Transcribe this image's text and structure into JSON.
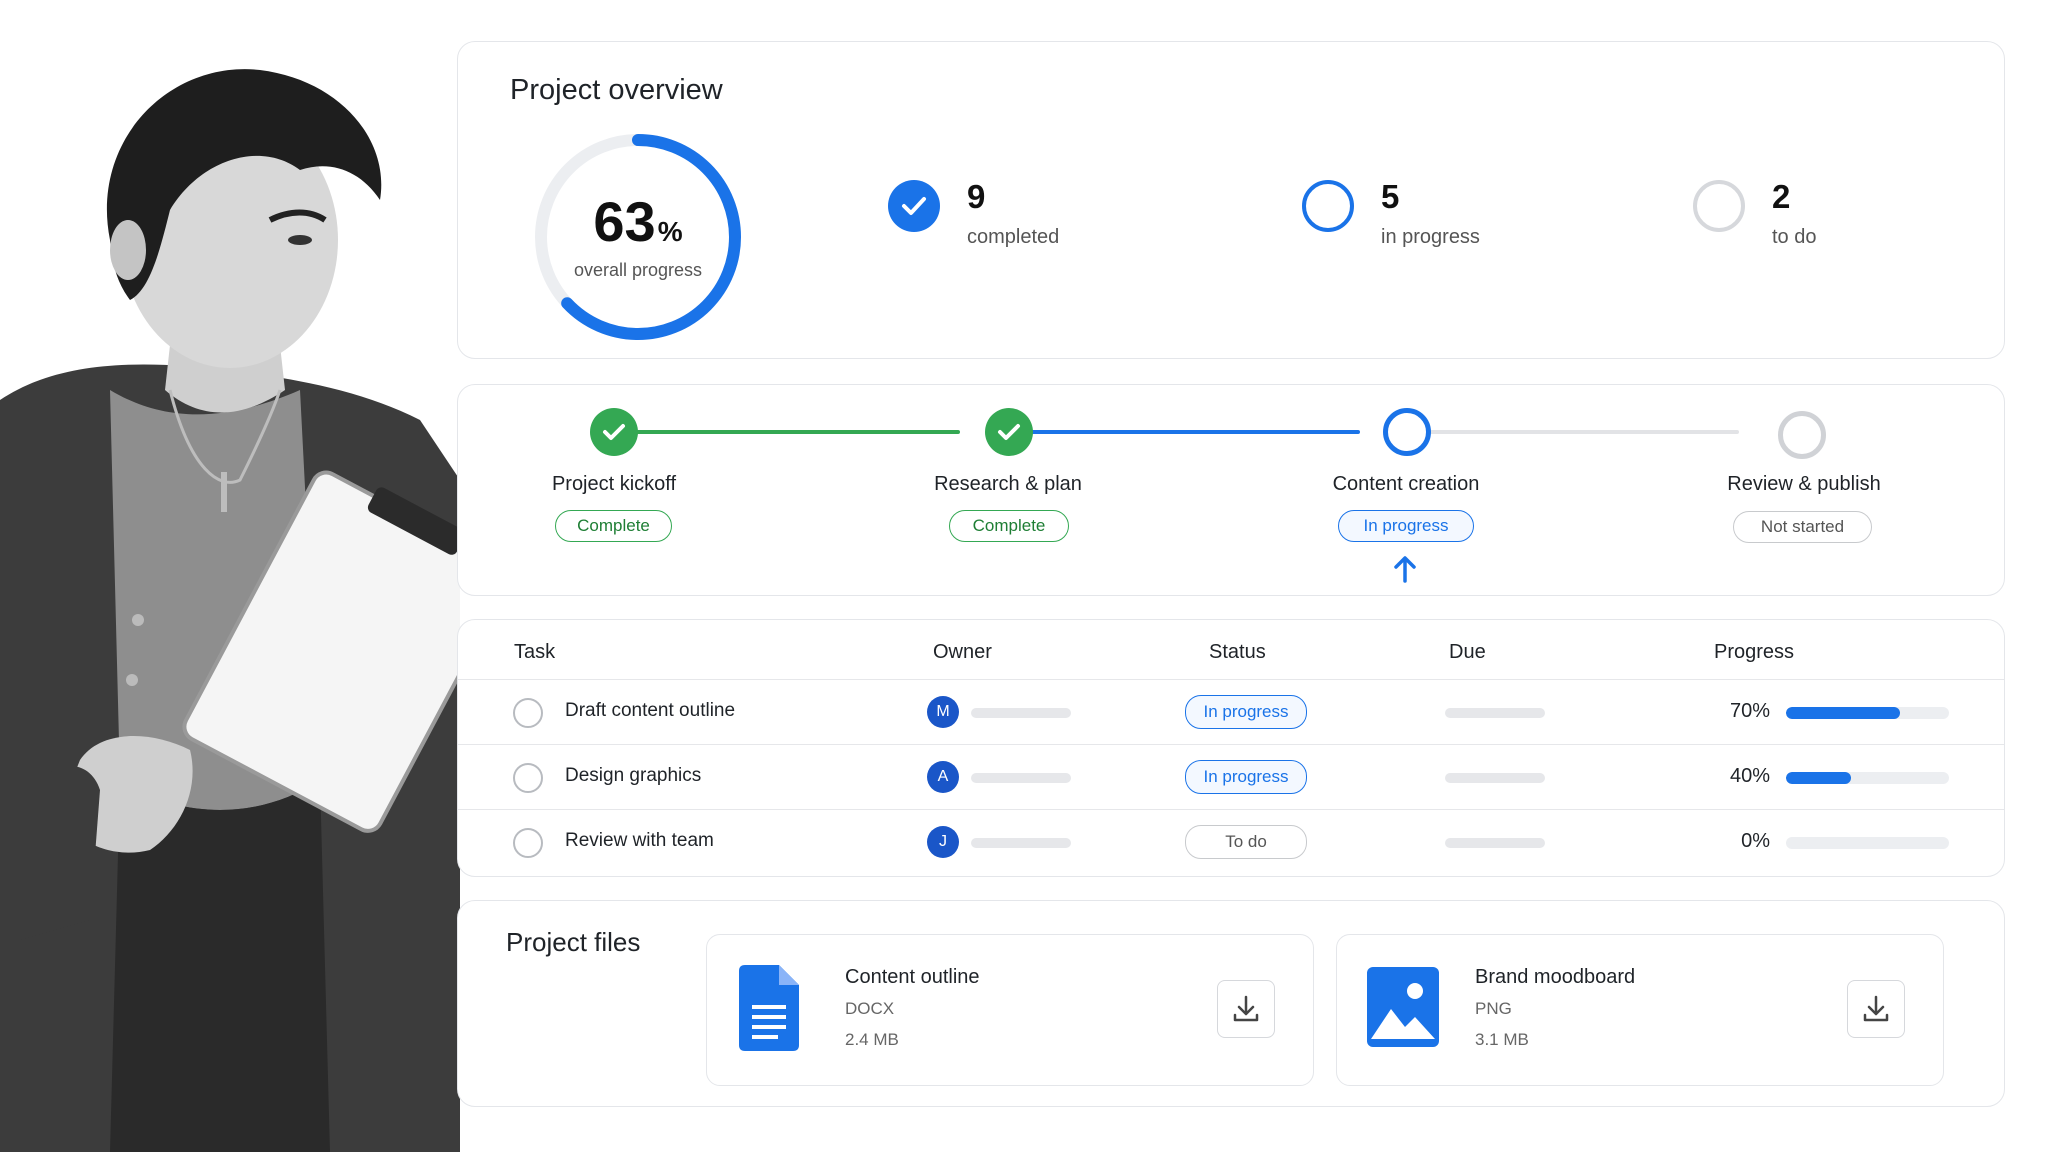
{
  "overview": {
    "title": "Project overview",
    "progress_value": "63",
    "progress_unit": "%",
    "progress_fraction": 0.63,
    "progress_label": "overall progress",
    "stats": [
      {
        "count": "9",
        "label": "completed"
      },
      {
        "count": "5",
        "label": "in progress"
      },
      {
        "count": "2",
        "label": "to do"
      }
    ]
  },
  "stages": [
    {
      "label": "Project kickoff",
      "status": "Complete"
    },
    {
      "label": "Research & plan",
      "status": "Complete"
    },
    {
      "label": "Content creation",
      "status": "In progress"
    },
    {
      "label": "Review & publish",
      "status": "Not started"
    }
  ],
  "tasks": {
    "headers": {
      "task": "Task",
      "owner": "Owner",
      "status": "Status",
      "due": "Due",
      "progress": "Progress"
    },
    "rows": [
      {
        "name": "Draft content outline",
        "owner_initial": "M",
        "status": "In progress",
        "progress_label": "70%",
        "progress": 0.7
      },
      {
        "name": "Design graphics",
        "owner_initial": "A",
        "status": "In progress",
        "progress_label": "40%",
        "progress": 0.4
      },
      {
        "name": "Review with team",
        "owner_initial": "J",
        "status": "To do",
        "progress_label": "0%",
        "progress": 0.0
      }
    ]
  },
  "files": {
    "title": "Project files",
    "items": [
      {
        "name": "Content outline",
        "type": "DOCX",
        "size": "2.4 MB",
        "icon": "document-icon"
      },
      {
        "name": "Brand moodboard",
        "type": "PNG",
        "size": "3.1 MB",
        "icon": "image-icon"
      }
    ]
  },
  "colors": {
    "accent": "#1a73e8",
    "success": "#34a853",
    "muted": "#d0d2d6"
  }
}
